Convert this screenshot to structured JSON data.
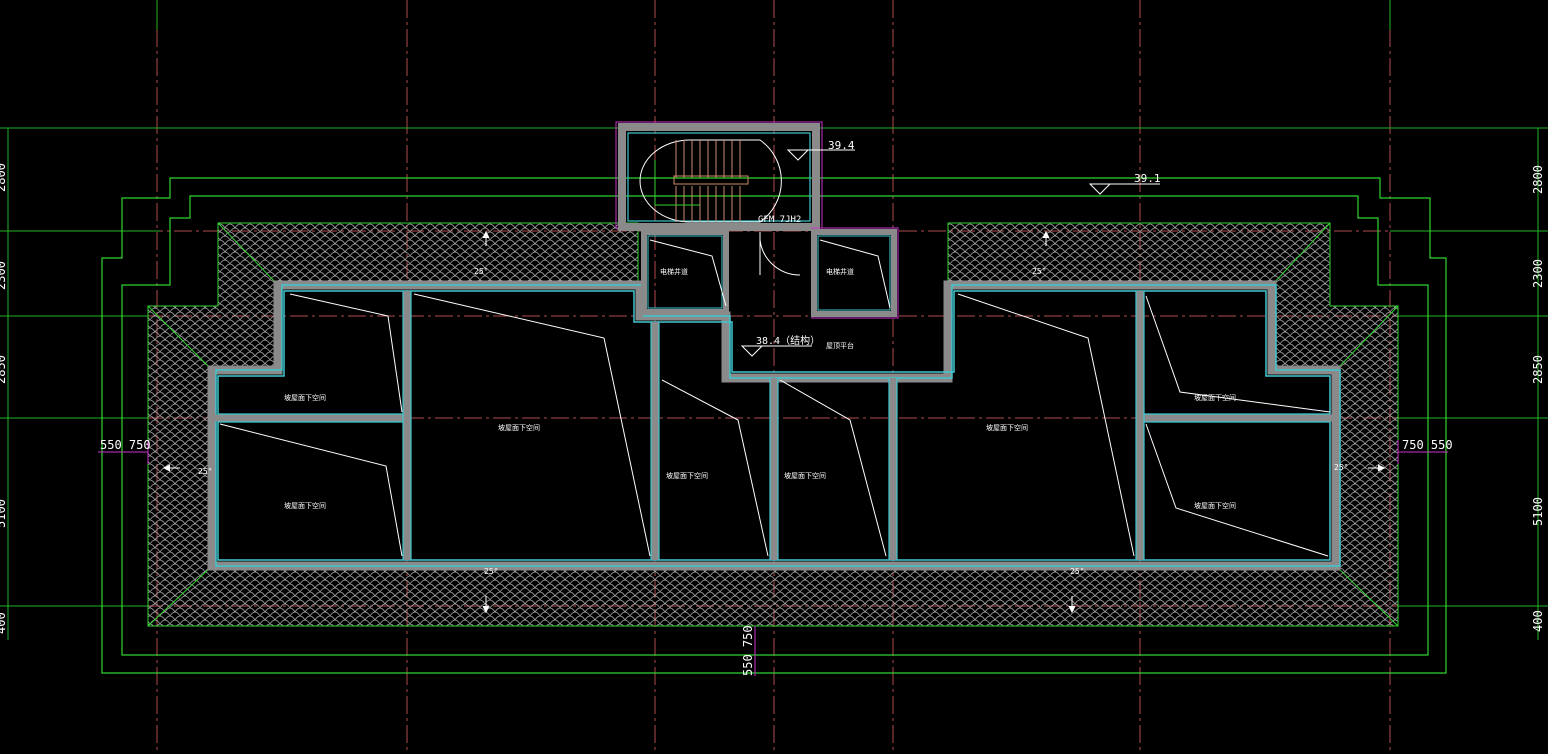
{
  "colors": {
    "background": "#000000",
    "grid_axis": "#c25a5a",
    "grid_green": "#2ecc2e",
    "outline_green": "#33dd33",
    "wall_cyan": "#3ec8d0",
    "wall_grey": "#8a8a8a",
    "magenta": "#cc33cc",
    "tile": "#b8b8b8",
    "text": "#ffffff"
  },
  "elevations": {
    "stair_top": "39.4",
    "roof_ridge": "39.1",
    "structure": "38.4（结构）"
  },
  "door_label": "GFM 7JH2",
  "slope_label": "25°",
  "room_labels": {
    "elevator_shaft": "电梯井道",
    "stair_landing": "屋顶平台",
    "attic_space": "坡屋面下空间"
  },
  "dimensions": {
    "left_vertical": [
      "2800",
      "2300",
      "2850",
      "5100",
      "400"
    ],
    "right_vertical": [
      "2800",
      "2300",
      "2850",
      "5100",
      "400"
    ],
    "left_offset": "550 750",
    "right_offset": "750 550",
    "bottom_offset": "550 750"
  }
}
